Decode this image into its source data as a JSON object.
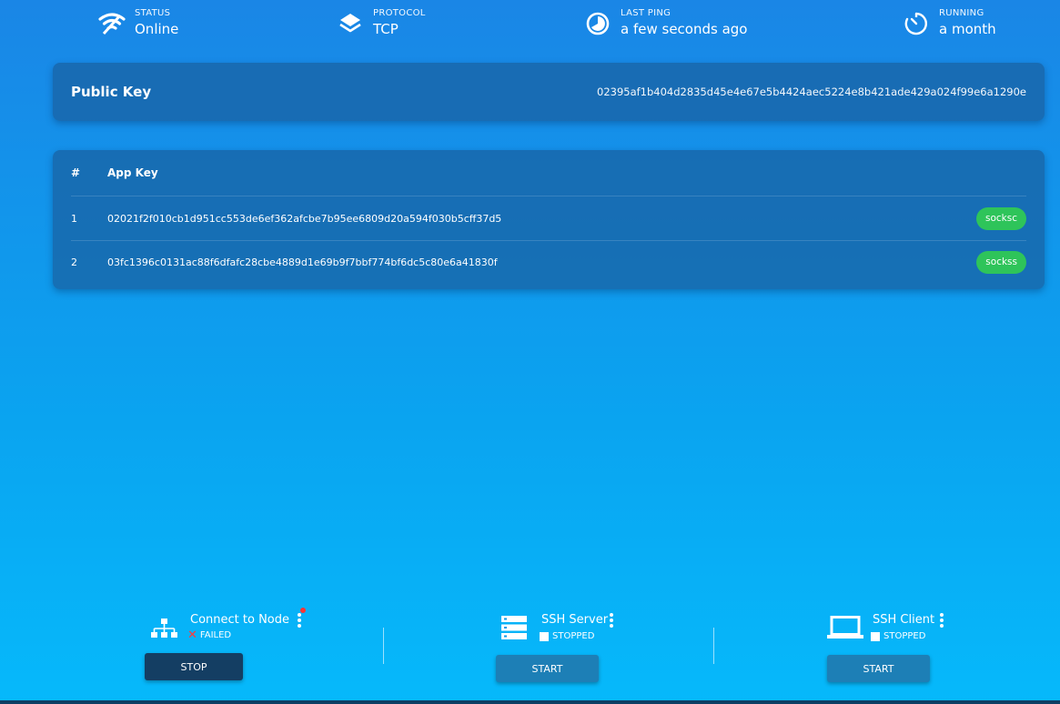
{
  "status_bar": {
    "status": {
      "label": "STATUS",
      "value": "Online",
      "icon": "wifi-icon"
    },
    "protocol": {
      "label": "PROTOCOL",
      "value": "TCP",
      "icon": "layers-icon"
    },
    "last_ping": {
      "label": "LAST PING",
      "value": "a few seconds ago",
      "icon": "pie-chart-icon"
    },
    "running": {
      "label": "RUNNING",
      "value": "a month",
      "icon": "timer-icon"
    }
  },
  "public_key": {
    "title": "Public Key",
    "value": "02395af1b404d2835d45e4e67e5b4424aec5224e8b421ade429a024f99e6a1290e"
  },
  "apps_table": {
    "headers": {
      "num": "#",
      "key": "App Key"
    },
    "rows": [
      {
        "num": "1",
        "key": "02021f2f010cb1d951cc553de6ef362afcbe7b95ee6809d20a594f030b5cff37d5",
        "app": "socksc"
      },
      {
        "num": "2",
        "key": "03fc1396c0131ac88f6dfafc28cbe4889d1e69b9f7bbf774bf6dc5c80e6a41830f",
        "app": "sockss"
      }
    ]
  },
  "bottom_apps": [
    {
      "name": "Connect to Node",
      "state": "FAILED",
      "button": "STOP",
      "icon": "network-icon"
    },
    {
      "name": "SSH Server",
      "state": "STOPPED",
      "button": "START",
      "icon": "server-icon"
    },
    {
      "name": "SSH Client",
      "state": "STOPPED",
      "button": "START",
      "icon": "laptop-icon"
    }
  ],
  "colors": {
    "badge": "#2ec45a",
    "failed": "#ff3b3b",
    "stop_button": "#143e63",
    "start_button": "#1d7fb6"
  }
}
